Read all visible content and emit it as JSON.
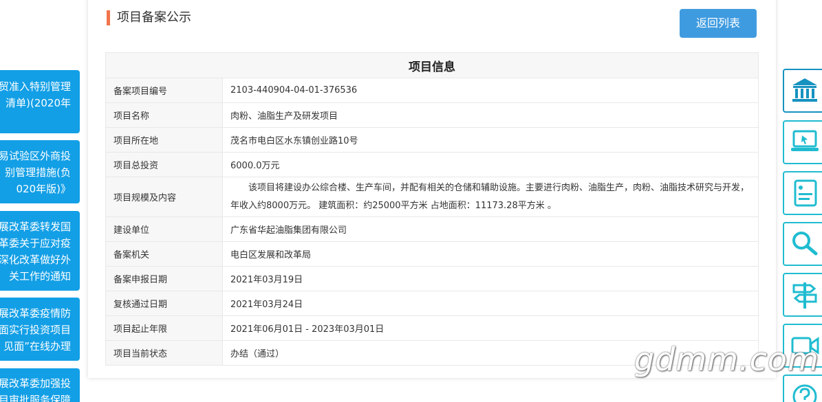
{
  "left_links": [
    {
      "lines": [
        "贸准入特别管理",
        "清单)(2020年"
      ]
    },
    {
      "lines": [
        "易试验区外商投",
        "别管理措施(负",
        "020年版)》"
      ]
    },
    {
      "lines": [
        "展改革委转发国",
        "革委关于应对疫",
        "深化改革做好外",
        "关工作的通知"
      ]
    },
    {
      "lines": [
        "展改革委疫情防",
        "面实行投资项目",
        "见面”在线办理"
      ]
    },
    {
      "lines": [
        "展改革委加强投",
        "目审批服务保障"
      ]
    }
  ],
  "page": {
    "title": "项目备案公示",
    "back_label": "返回列表"
  },
  "table": {
    "header": "项目信息",
    "rows": [
      {
        "label": "备案项目编号",
        "value": "2103-440904-04-01-376536"
      },
      {
        "label": "项目名称",
        "value": "肉粉、油脂生产及研发项目"
      },
      {
        "label": "项目所在地",
        "value": "茂名市电白区水东镇创业路10号"
      },
      {
        "label": "项目总投资",
        "value": "6000.0万元"
      },
      {
        "label": "项目规模及内容",
        "value": "该项目将建设办公综合楼、生产车间，并配有相关的仓储和辅助设施。主要进行肉粉、油脂生产，肉粉、油脂技术研究与开发，年收入约8000万元。      建筑面积：约25000平方米 占地面积：11173.28平方米 。"
      },
      {
        "label": "建设单位",
        "value": "广东省华起油脂集团有限公司"
      },
      {
        "label": "备案机关",
        "value": "电白区发展和改革局"
      },
      {
        "label": "备案申报日期",
        "value": "2021年03月19日"
      },
      {
        "label": "复核通过日期",
        "value": "2021年03月24日"
      },
      {
        "label": "项目起止年限",
        "value": "2021年06月01日 - 2023年03月01日"
      },
      {
        "label": "项目当前状态",
        "value": "办结（通过）"
      }
    ]
  },
  "sidebar_icons": [
    "bank-icon",
    "monitor-icon",
    "document-icon",
    "search-icon",
    "signpost-icon",
    "video-icon",
    "help-icon"
  ],
  "accent_colors": {
    "link_bg": "#139fe6",
    "button": "#3f9be0",
    "title_bar": "#f2744c",
    "side_border": "#1fbcd0"
  },
  "watermark": "gdmm.com"
}
